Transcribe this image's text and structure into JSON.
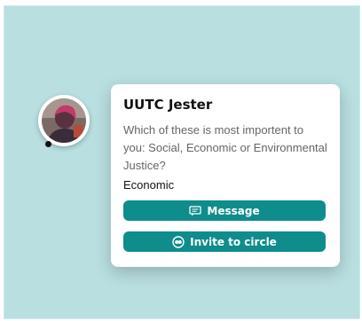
{
  "card": {
    "name": "UUTC Jester",
    "question": "Which of these is most importent to you: Social, Economic or Environmental Justice?",
    "answer": "Economic",
    "message_label": "Message",
    "invite_label": "Invite to circle"
  },
  "icons": {
    "message": "message-icon",
    "invite": "invite-circle-icon"
  },
  "colors": {
    "background": "#b9dfe1",
    "button": "#0f8c8c",
    "card": "#ffffff"
  }
}
